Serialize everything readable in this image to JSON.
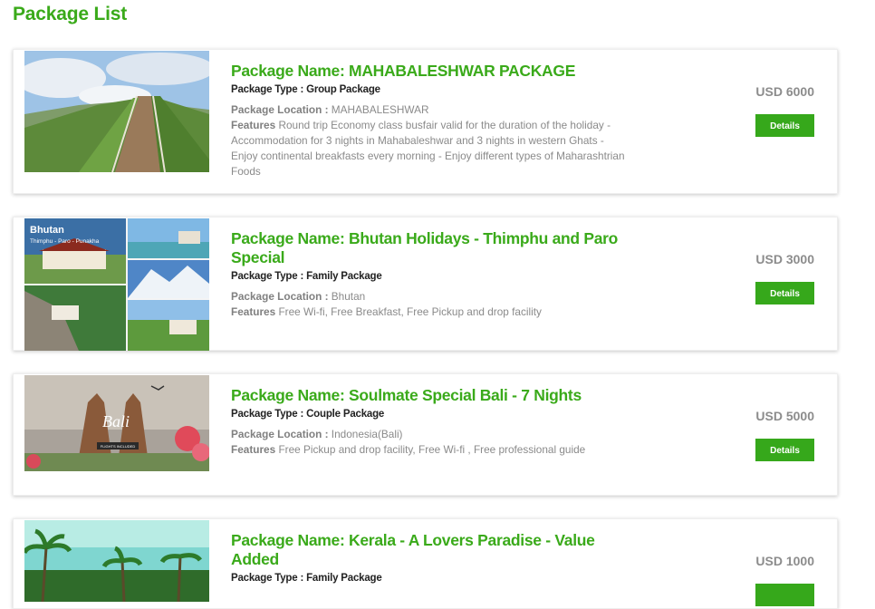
{
  "page": {
    "title": "Package List"
  },
  "packages": [
    {
      "name": "Package Name: MAHABALESHWAR PACKAGE",
      "type_label": "Package Type : ",
      "type": "Group Package",
      "location_label": "Package Location : ",
      "location": "MAHABALESHWAR",
      "features_label": "Features",
      "features": "Round trip Economy class busfair valid for the duration of the holiday - Accommodation for 3 nights in Mahabaleshwar and 3 nights in western Ghats - Enjoy continental breakfasts every morning - Enjoy different types of Maharashtrian Foods",
      "price": "USD 6000",
      "button": "Details"
    },
    {
      "name": "Package Name: Bhutan Holidays - Thimphu and Paro Special",
      "type_label": "Package Type : ",
      "type": "Family Package",
      "location_label": "Package Location : ",
      "location": "Bhutan",
      "features_label": "Features",
      "features": "Free Wi-fi, Free Breakfast, Free Pickup and drop facility",
      "price": "USD 3000",
      "button": "Details",
      "image_title": "Bhutan",
      "image_subtitle": "Thimphu - Paro - Punakha"
    },
    {
      "name": "Package Name: Soulmate Special Bali - 7 Nights",
      "type_label": "Package Type : ",
      "type": "Couple Package",
      "location_label": "Package Location : ",
      "location": "Indonesia(Bali)",
      "features_label": "Features",
      "features": "Free Pickup and drop facility, Free Wi-fi , Free professional guide",
      "price": "USD 5000",
      "button": "Details",
      "image_title": "Bali",
      "image_subtitle": "FLIGHTS INCLUDED"
    },
    {
      "name": "Package Name: Kerala - A Lovers Paradise - Value Added",
      "type_label": "Package Type : ",
      "type": "Family Package",
      "price": "USD 1000"
    }
  ],
  "colors": {
    "accent": "#3aaa1a",
    "button": "#36a81b",
    "price": "#8c8c8c"
  }
}
